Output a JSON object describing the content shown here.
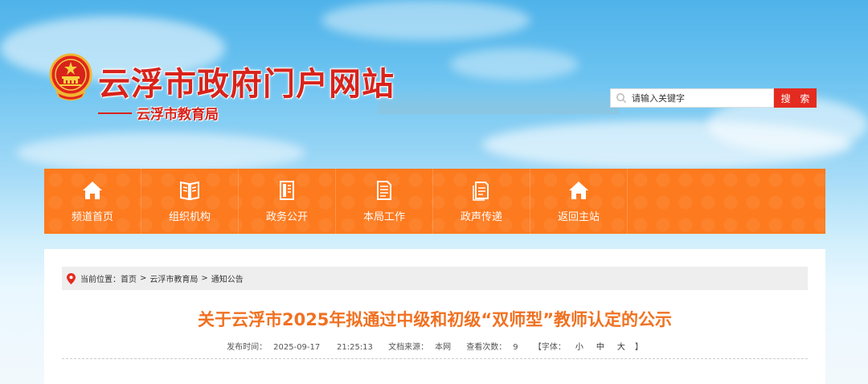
{
  "header": {
    "site_title": "云浮市政府门户网站",
    "sub_title": "云浮市教育局"
  },
  "search": {
    "placeholder": "请输入关键字",
    "button_label": "搜 索"
  },
  "nav": {
    "items": [
      {
        "label": "频道首页",
        "icon": "home-icon"
      },
      {
        "label": "组织机构",
        "icon": "book-icon"
      },
      {
        "label": "政务公开",
        "icon": "document-icon"
      },
      {
        "label": "本局工作",
        "icon": "list-document-icon"
      },
      {
        "label": "政声传递",
        "icon": "notes-icon"
      },
      {
        "label": "返回主站",
        "icon": "home-icon"
      }
    ]
  },
  "breadcrumb": {
    "prefix": "当前位置：",
    "items": [
      "首页",
      "云浮市教育局",
      "通知公告"
    ],
    "separator": ">"
  },
  "article": {
    "title": "关于云浮市2025年拟通过中级和初级“双师型”教师认定的公示",
    "publish_label": "发布时间：",
    "publish_date": "2025-09-17",
    "publish_time": "21:25:13",
    "source_label": "文档来源：",
    "source": "本网",
    "views_label": "查看次数：",
    "views": "9",
    "font_label": "【字体：",
    "font_small": "小",
    "font_medium": "中",
    "font_large": "大",
    "font_close": "】"
  },
  "colors": {
    "accent_red": "#d8231b",
    "nav_orange": "#fd7a1f",
    "title_orange": "#f07121",
    "search_button": "#e42b20"
  }
}
